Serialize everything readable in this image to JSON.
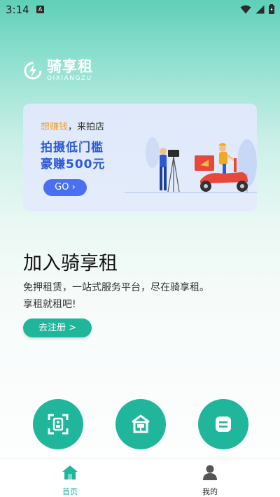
{
  "status_bar": {
    "time": "3:14",
    "notification_badge": "A"
  },
  "brand": {
    "name": "骑享租",
    "subtitle": "QIXIANGZU"
  },
  "banner": {
    "line1_highlight": "想赚钱",
    "line1_rest": "，来拍店",
    "line2": "拍摄低门槛",
    "line3": "豪赚500元",
    "go_label": "GO ›"
  },
  "join": {
    "title": "加入骑享租",
    "desc_line1": "免押租赁，一站式服务平台，尽在骑享租。",
    "desc_line2": "享租就租吧!",
    "register_label": "去注册 >"
  },
  "quick_actions": [
    {
      "icon": "id-card-scan-icon"
    },
    {
      "icon": "store-icon"
    },
    {
      "icon": "menu-list-icon"
    }
  ],
  "bottom_nav": {
    "home_label": "首页",
    "mine_label": "我的"
  },
  "colors": {
    "accent": "#20b69b",
    "banner_blue": "#2a5bd7",
    "highlight": "#f2a12b"
  }
}
